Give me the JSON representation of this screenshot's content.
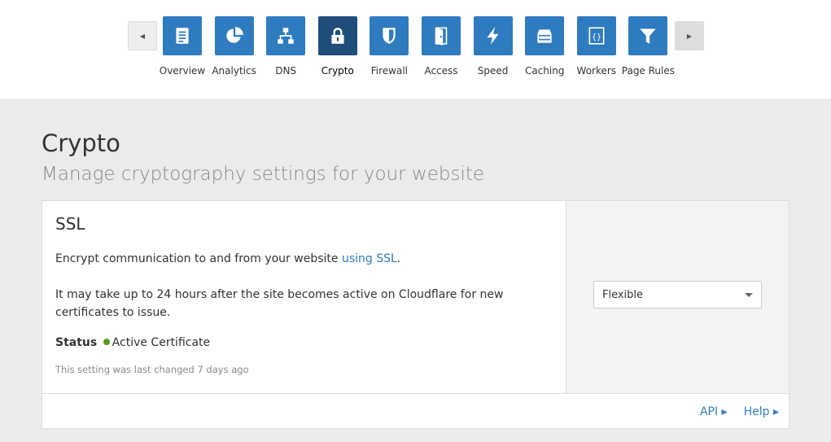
{
  "nav": {
    "items": [
      {
        "label": "Overview",
        "icon": "clipboard-icon"
      },
      {
        "label": "Analytics",
        "icon": "pie-chart-icon"
      },
      {
        "label": "DNS",
        "icon": "sitemap-icon"
      },
      {
        "label": "Crypto",
        "icon": "lock-icon",
        "active": true
      },
      {
        "label": "Firewall",
        "icon": "shield-icon"
      },
      {
        "label": "Access",
        "icon": "door-icon"
      },
      {
        "label": "Speed",
        "icon": "lightning-icon"
      },
      {
        "label": "Caching",
        "icon": "server-icon"
      },
      {
        "label": "Workers",
        "icon": "code-braces-icon"
      },
      {
        "label": "Page Rules",
        "icon": "filter-icon"
      }
    ]
  },
  "page": {
    "title": "Crypto",
    "subtitle": "Manage cryptography settings for your website"
  },
  "ssl": {
    "title": "SSL",
    "desc_before": "Encrypt communication to and from your website ",
    "desc_link": "using SSL",
    "desc_after": ".",
    "note": "It may take up to 24 hours after the site becomes active on Cloudflare for new certificates to issue.",
    "status_label": "Status",
    "status_value": "Active Certificate",
    "status_color": "#5b9a1f",
    "changed": "This setting was last changed 7 days ago",
    "mode": "Flexible",
    "api": "API",
    "help": "Help"
  },
  "colors": {
    "accent": "#2f7bbf",
    "active": "#1f4d7a"
  }
}
